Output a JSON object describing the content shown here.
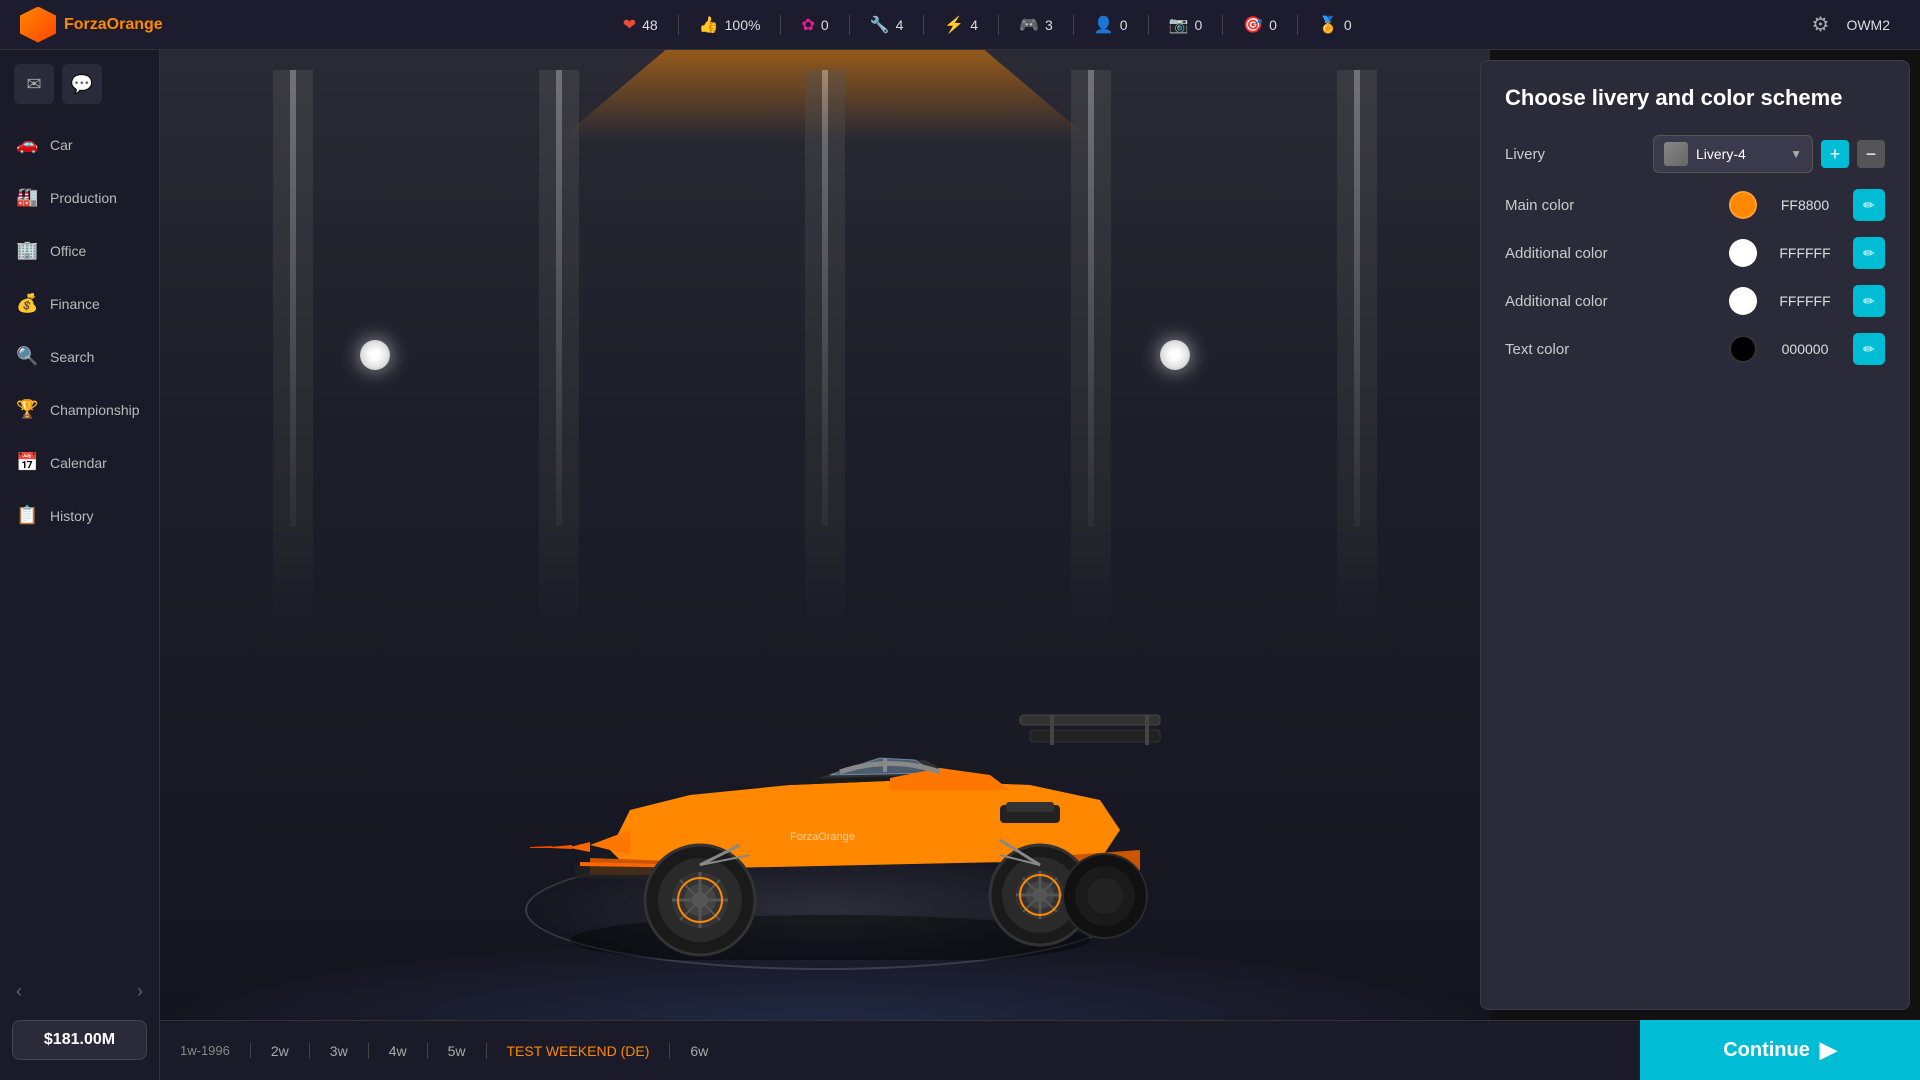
{
  "app": {
    "name": "ForzaOrange"
  },
  "topbar": {
    "stats": [
      {
        "id": "hearts",
        "icon": "❤",
        "value": "48",
        "color": "heart"
      },
      {
        "id": "shield",
        "icon": "👍",
        "value": "100%",
        "color": "shield"
      },
      {
        "id": "pink",
        "icon": "🌸",
        "value": "0",
        "color": "pink"
      },
      {
        "id": "wrench",
        "icon": "🔧",
        "value": "4",
        "color": "wrench"
      },
      {
        "id": "bolt",
        "icon": "⚡",
        "value": "4",
        "color": "star"
      },
      {
        "id": "team",
        "icon": "🎮",
        "value": "3",
        "color": "team"
      },
      {
        "id": "person",
        "icon": "👤",
        "value": "0",
        "color": "person"
      },
      {
        "id": "camera",
        "icon": "📷",
        "value": "0",
        "color": "person"
      },
      {
        "id": "target",
        "icon": "🎯",
        "value": "0",
        "color": "pink"
      },
      {
        "id": "medal",
        "icon": "🏅",
        "value": "0",
        "color": "medal"
      }
    ],
    "username": "OWM2"
  },
  "sidebar": {
    "nav_items": [
      {
        "id": "car",
        "icon": "🚗",
        "label": "Car"
      },
      {
        "id": "production",
        "icon": "🏭",
        "label": "Production"
      },
      {
        "id": "office",
        "icon": "🏢",
        "label": "Office"
      },
      {
        "id": "finance",
        "icon": "💰",
        "label": "Finance"
      },
      {
        "id": "search",
        "icon": "🔍",
        "label": "Search"
      },
      {
        "id": "championship",
        "icon": "🏆",
        "label": "Championship"
      },
      {
        "id": "calendar",
        "icon": "📅",
        "label": "Calendar"
      },
      {
        "id": "history",
        "icon": "📋",
        "label": "History"
      }
    ],
    "money": "$181.00M"
  },
  "panel": {
    "title": "Choose livery and color scheme",
    "livery_label": "Livery",
    "livery_value": "Livery-4",
    "colors": [
      {
        "id": "main",
        "label": "Main color",
        "hex": "FF8800",
        "swatch": "#FF8800"
      },
      {
        "id": "additional1",
        "label": "Additional color",
        "hex": "FFFFFF",
        "swatch": "#FFFFFF"
      },
      {
        "id": "additional2",
        "label": "Additional color",
        "hex": "FFFFFF",
        "swatch": "#FFFFFF"
      },
      {
        "id": "text",
        "label": "Text color",
        "hex": "000000",
        "swatch": "#000000"
      }
    ]
  },
  "timeline": {
    "current": "1w-1996",
    "weeks": [
      {
        "id": "2w",
        "label": "2w",
        "event": ""
      },
      {
        "id": "3w",
        "label": "3w",
        "event": ""
      },
      {
        "id": "4w",
        "label": "4w",
        "event": ""
      },
      {
        "id": "5w",
        "label": "5w",
        "event": ""
      },
      {
        "id": "test",
        "label": "TEST WEEKEND (DE)",
        "event": "test"
      },
      {
        "id": "6w",
        "label": "6w",
        "event": ""
      }
    ]
  },
  "continue_btn": "Continue"
}
